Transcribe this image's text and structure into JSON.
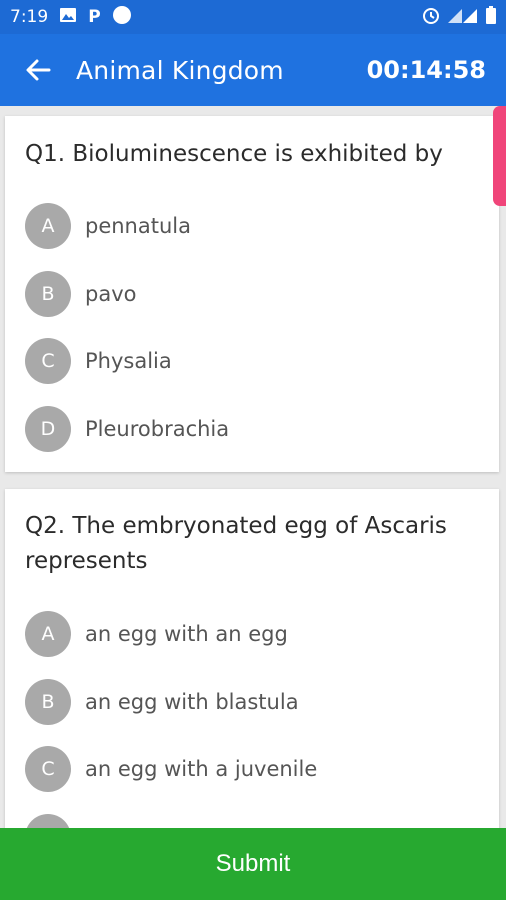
{
  "status_bar": {
    "time": "7:19",
    "icons": [
      "image-icon",
      "parking-icon",
      "circle-icon",
      "alarm-icon",
      "signal-icon",
      "battery-icon"
    ]
  },
  "app_bar": {
    "back_icon": "arrow-left-icon",
    "title": "Animal Kingdom",
    "timer": "00:14:58"
  },
  "questions": [
    {
      "text": "Q1. Bioluminescence is exhibited by",
      "options": [
        {
          "letter": "A",
          "text": "pennatula"
        },
        {
          "letter": "B",
          "text": "pavo"
        },
        {
          "letter": "C",
          "text": "Physalia"
        },
        {
          "letter": "D",
          "text": "Pleurobrachia"
        }
      ]
    },
    {
      "text_line1": "Q2. The embryonated egg of Ascaris",
      "text_line2": "represents",
      "options": [
        {
          "letter": "A",
          "text": "an egg with an egg"
        },
        {
          "letter": "B",
          "text": "an egg with blastula"
        },
        {
          "letter": "C",
          "text": "an egg with a juvenile"
        }
      ]
    }
  ],
  "submit_label": "Submit",
  "colors": {
    "status_bar": "#1d6ad4",
    "app_bar": "#1f72e0",
    "submit": "#27a930",
    "scroll_indicator": "#f0457a",
    "option_circle": "#a9a9a9"
  }
}
